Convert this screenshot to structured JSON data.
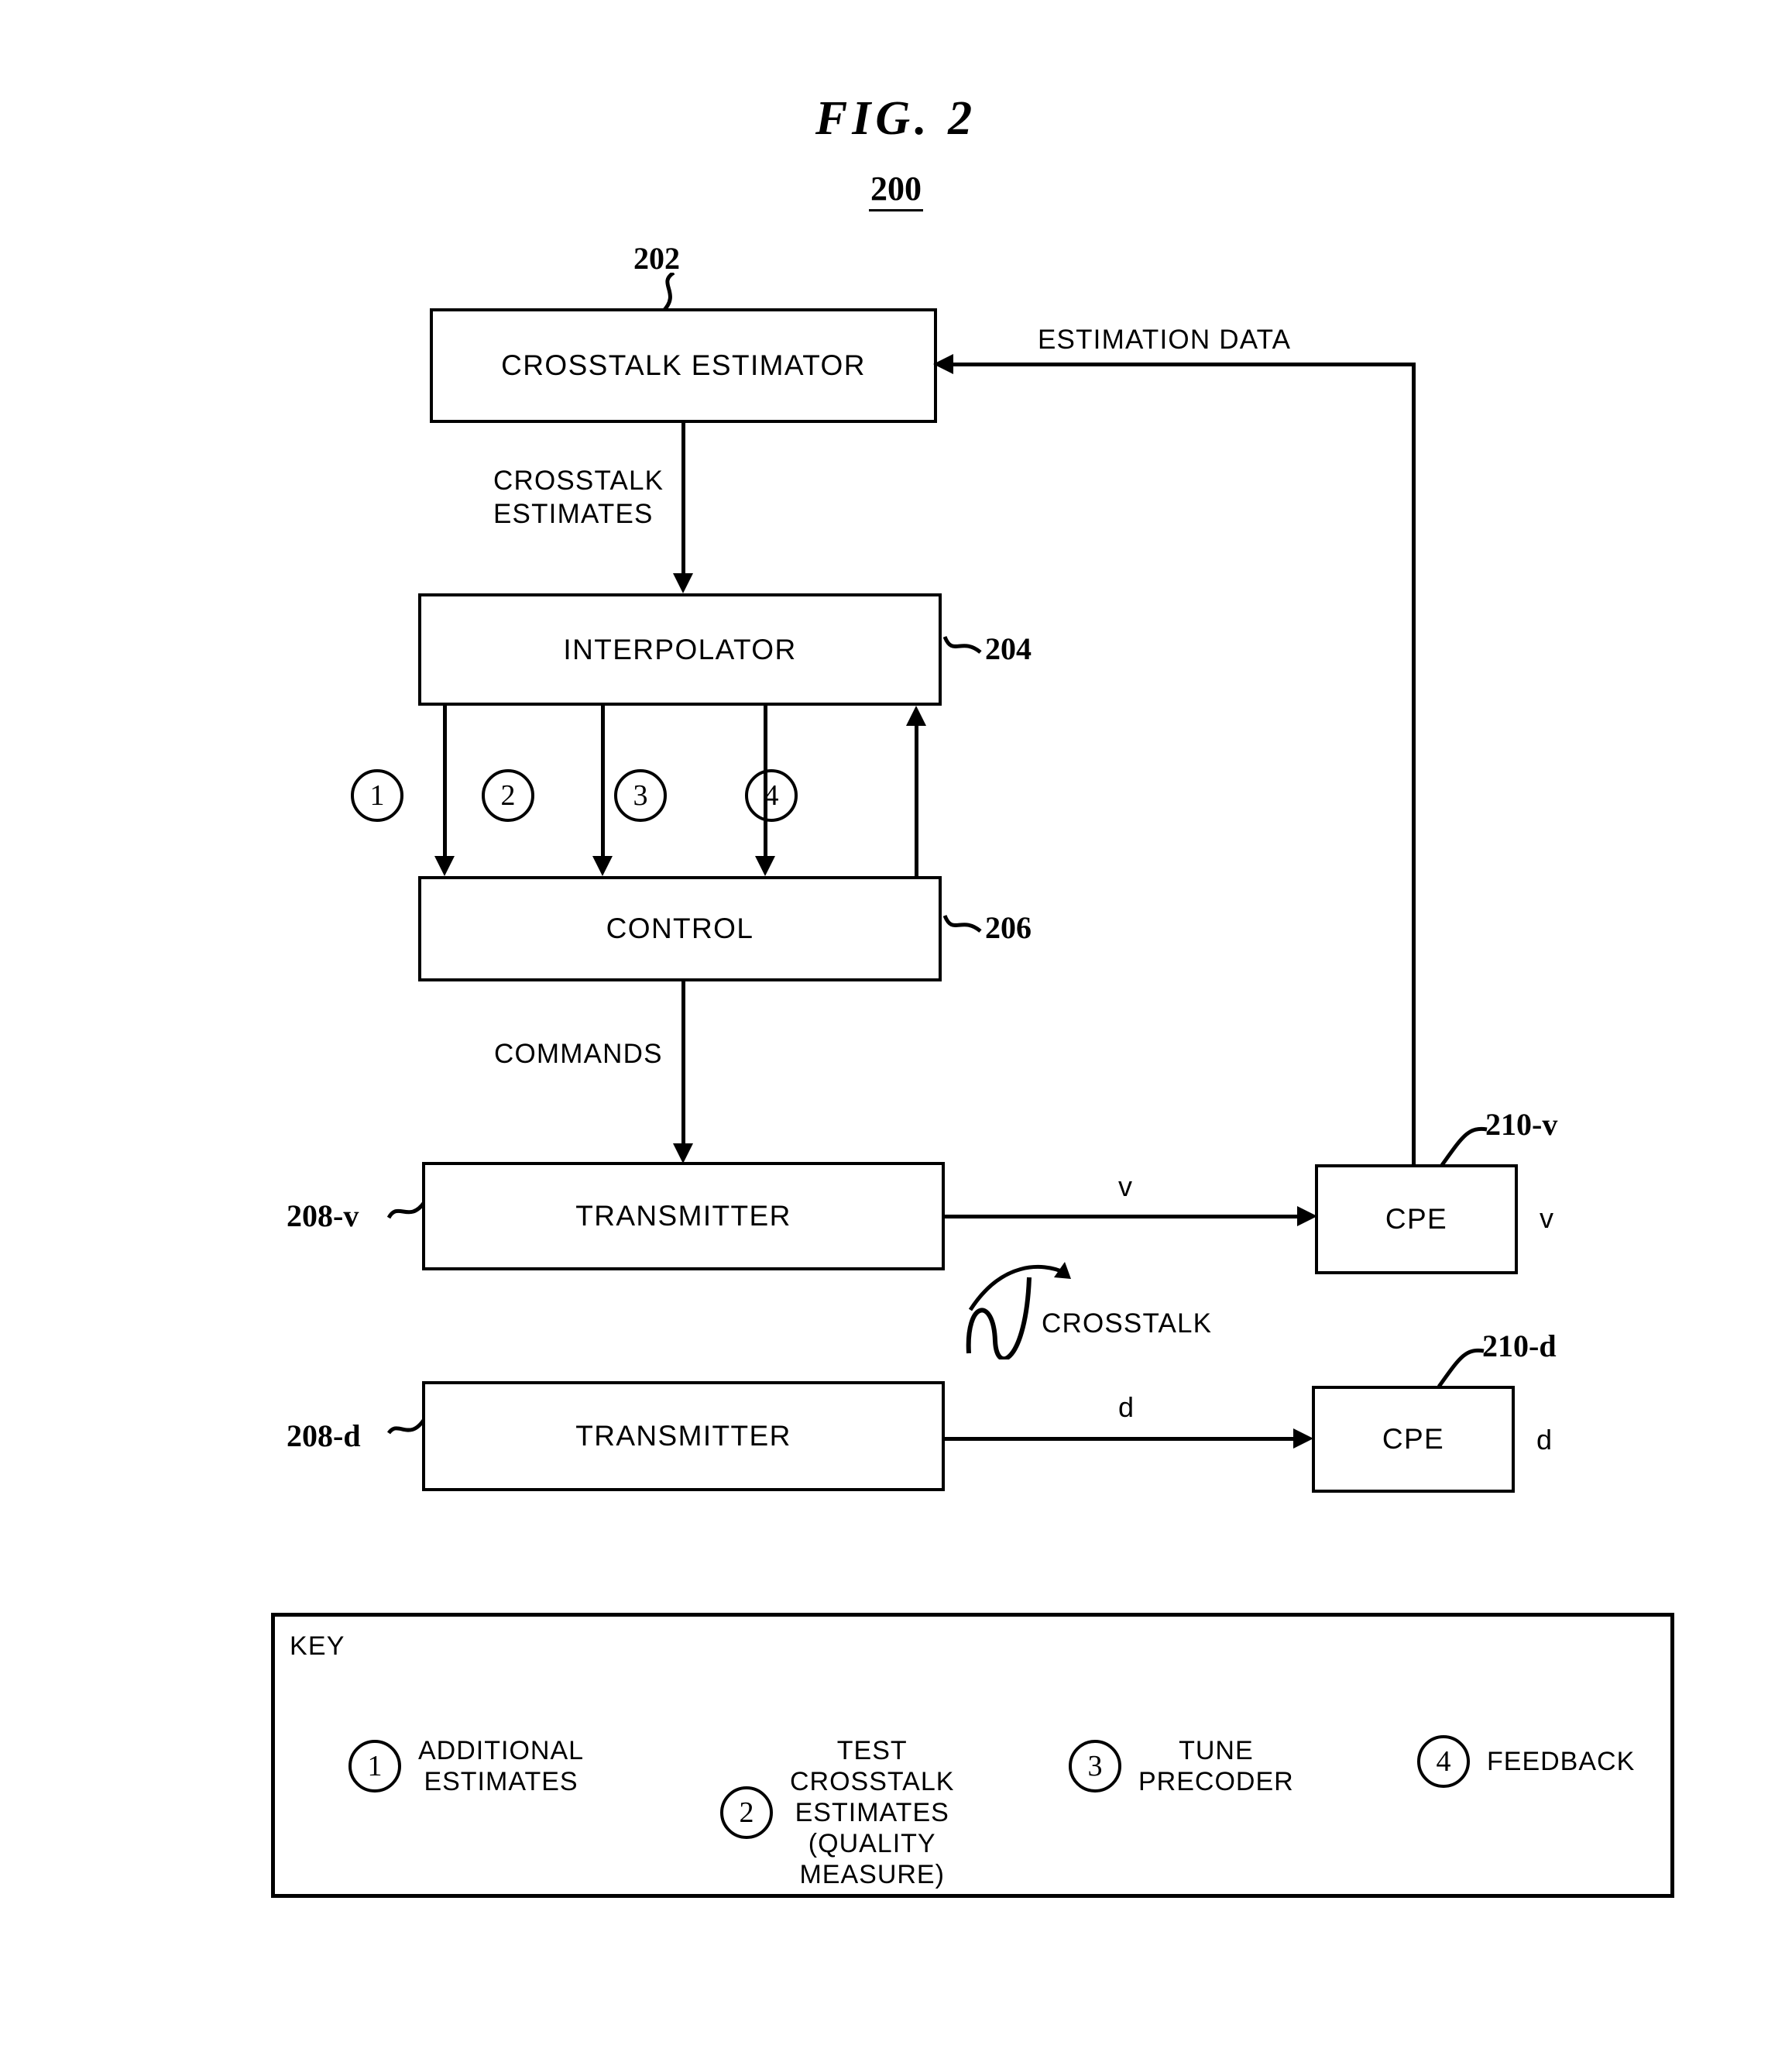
{
  "figure": {
    "title": "FIG. 2",
    "number": "200"
  },
  "blocks": {
    "crosstalk_estimator": {
      "label": "CROSSTALK  ESTIMATOR",
      "ref": "202"
    },
    "interpolator": {
      "label": "INTERPOLATOR",
      "ref": "204"
    },
    "control": {
      "label": "CONTROL",
      "ref": "206"
    },
    "transmitter_v": {
      "label": "TRANSMITTER",
      "ref": "208-v"
    },
    "transmitter_d": {
      "label": "TRANSMITTER",
      "ref": "208-d"
    },
    "cpe_v": {
      "label": "CPE",
      "ref": "210-v"
    },
    "cpe_d": {
      "label": "CPE",
      "ref": "210-d"
    }
  },
  "flow_labels": {
    "estimation_data": "ESTIMATION  DATA",
    "crosstalk_estimates": "CROSSTALK\nESTIMATES",
    "commands": "COMMANDS",
    "crosstalk": "CROSSTALK"
  },
  "channels": {
    "line_v_label": "v",
    "cpe_v_out": "v",
    "line_d_label": "d",
    "cpe_d_out": "d"
  },
  "markers": {
    "one": "1",
    "two": "2",
    "three": "3",
    "four": "4"
  },
  "key": {
    "title": "KEY",
    "items": [
      {
        "num": "1",
        "text": "ADDITIONAL\nESTIMATES"
      },
      {
        "num": "2",
        "text": "TEST\nCROSSTALK\nESTIMATES\n(QUALITY\nMEASURE)"
      },
      {
        "num": "3",
        "text": "TUNE\nPRECODER"
      },
      {
        "num": "4",
        "text": "FEEDBACK"
      }
    ]
  },
  "colors": {
    "ink": "#000000",
    "paper": "#ffffff"
  }
}
